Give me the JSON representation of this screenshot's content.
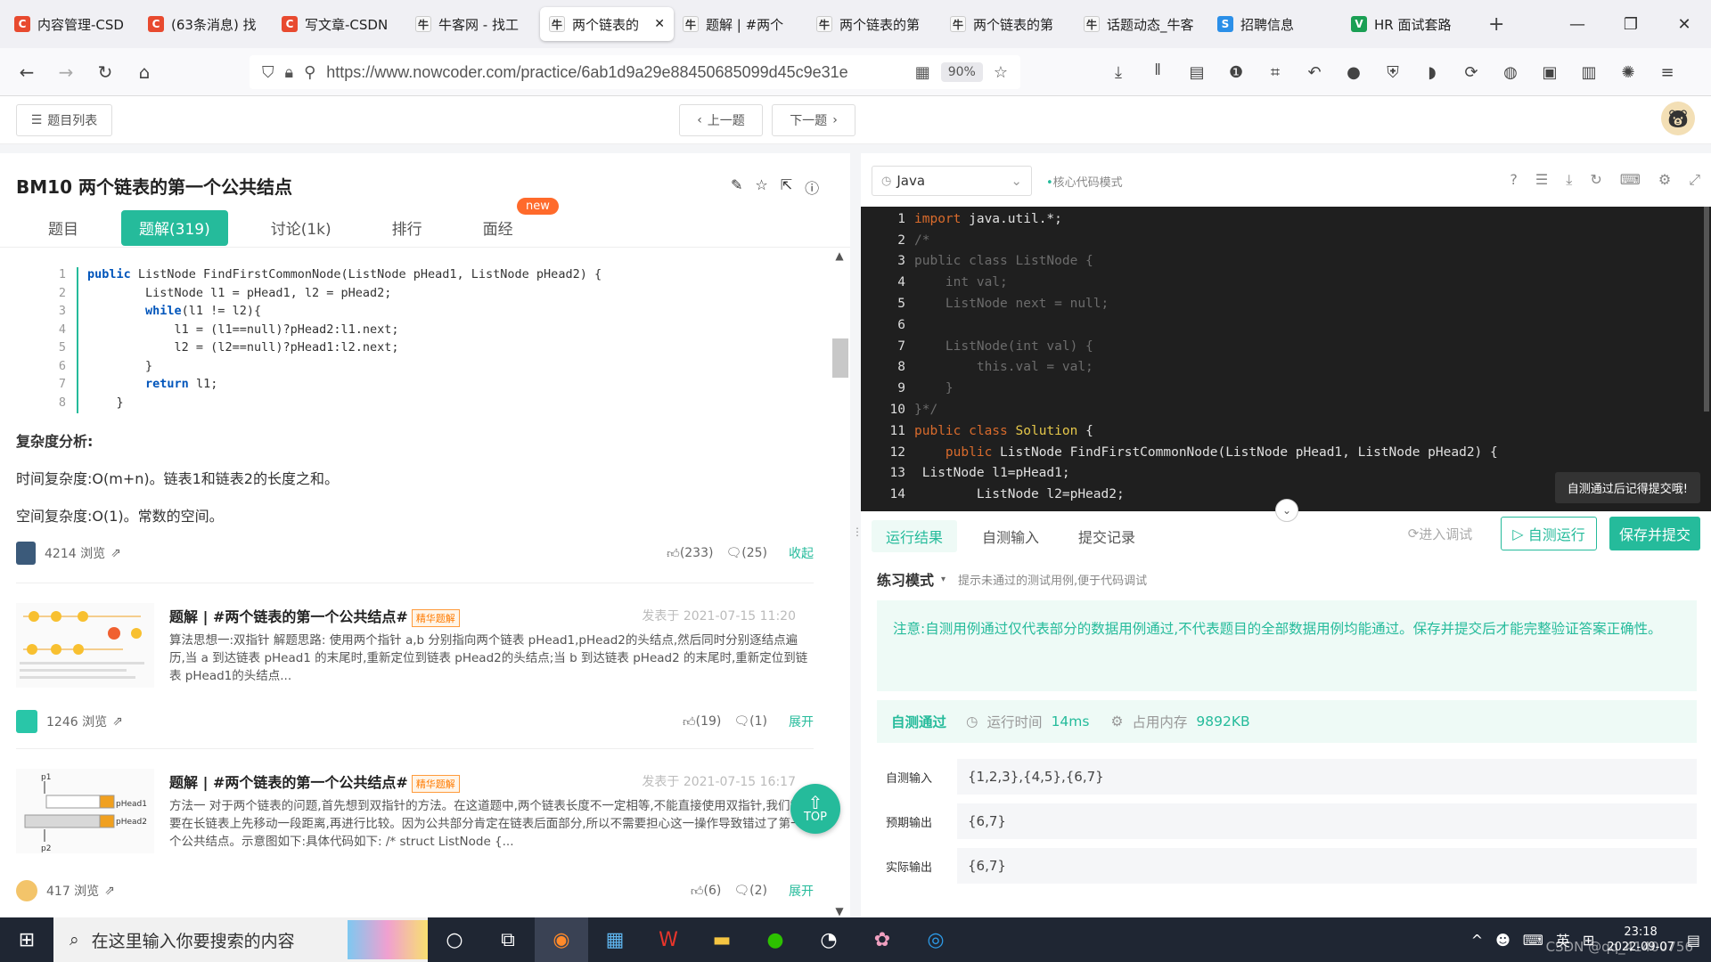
{
  "browser": {
    "tabs": [
      {
        "icon": "C",
        "color": "#e84a2f",
        "label": "内容管理-CSD"
      },
      {
        "icon": "C",
        "color": "#e84a2f",
        "label": "(63条消息) 找"
      },
      {
        "icon": "C",
        "color": "#e84a2f",
        "label": "写文章-CSDN"
      },
      {
        "icon": "牛",
        "color": "#f8f8f8",
        "label": "牛客网 - 找工"
      },
      {
        "icon": "牛",
        "color": "#f8f8f8",
        "label": "两个链表的",
        "active": true
      },
      {
        "icon": "牛",
        "color": "#f8f8f8",
        "label": "题解 | #两个"
      },
      {
        "icon": "牛",
        "color": "#f8f8f8",
        "label": "两个链表的第"
      },
      {
        "icon": "牛",
        "color": "#f8f8f8",
        "label": "两个链表的第"
      },
      {
        "icon": "牛",
        "color": "#f8f8f8",
        "label": "话题动态_牛客"
      },
      {
        "icon": "S",
        "color": "#2b8fe8",
        "label": "招聘信息"
      },
      {
        "icon": "V",
        "color": "#1a9f54",
        "label": "HR 面试套路"
      }
    ],
    "url": "https://www.nowcoder.com/practice/6ab1d9a29e88450685099d45c9e31e",
    "zoom": "90%"
  },
  "subheader": {
    "list_label": "题目列表",
    "prev_label": "上一题",
    "next_label": "下一题"
  },
  "problem": {
    "title": "BM10  两个链表的第一个公共结点",
    "tabs": [
      "题目",
      "题解(319)",
      "讨论(1k)",
      "排行",
      "面经"
    ],
    "new_badge": "new"
  },
  "solution_code": [
    {
      "n": "1",
      "pre": "",
      "kw": "public",
      "rest": " ListNode FindFirstCommonNode(ListNode pHead1, ListNode pHead2) {"
    },
    {
      "n": "2",
      "pre": "        ",
      "kw": "",
      "rest": "ListNode l1 = pHead1, l2 = pHead2;"
    },
    {
      "n": "3",
      "pre": "        ",
      "kw": "while",
      "rest": "(l1 != l2){"
    },
    {
      "n": "4",
      "pre": "            ",
      "kw": "",
      "rest": "l1 = (l1==null)?pHead2:l1.next;"
    },
    {
      "n": "5",
      "pre": "            ",
      "kw": "",
      "rest": "l2 = (l2==null)?pHead1:l2.next;"
    },
    {
      "n": "6",
      "pre": "        ",
      "kw": "",
      "rest": "}"
    },
    {
      "n": "7",
      "pre": "        ",
      "kw": "return",
      "rest": " l1;"
    },
    {
      "n": "8",
      "pre": "    ",
      "kw": "",
      "rest": "}"
    }
  ],
  "complexity": {
    "heading": "复杂度分析:",
    "time": "时间复杂度:O(m+n)。链表1和链表2的长度之和。",
    "space": "空间复杂度:O(1)。常数的空间。"
  },
  "first_post": {
    "views": "4214 浏览",
    "likes": "(233)",
    "comments": "(25)",
    "toggle": "收起"
  },
  "cards": [
    {
      "title": "题解 | #两个链表的第一个公共结点#",
      "badge": "精华题解",
      "date": "发表于 2021-07-15 11:20",
      "body": "算法思想一:双指针 解题思路: 使用两个指针 a,b 分别指向两个链表 pHead1,pHead2的头结点,然后同时分别逐结点遍历,当 a 到达链表 pHead1 的末尾时,重新定位到链表 pHead2的头结点;当 b 到达链表 pHead2 的末尾时,重新定位到链表 pHead1的头结点...",
      "views": "1246 浏览",
      "likes": "(19)",
      "comments": "(1)",
      "toggle": "展开"
    },
    {
      "title": "题解 | #两个链表的第一个公共结点#",
      "badge": "精华题解",
      "date": "发表于 2021-07-15 16:17",
      "body": "方法一 对于两个链表的问题,首先想到双指针的方法。在这道题中,两个链表长度不一定相等,不能直接使用双指针,我们需要在长链表上先移动一段距离,再进行比较。因为公共部分肯定在链表后面部分,所以不需要担心这一操作导致错过了第一个公共结点。示意图如下:具体代码如下: /* struct ListNode {...",
      "views": "417 浏览",
      "likes": "(6)",
      "comments": "(2)",
      "toggle": "展开",
      "thumb_labels": [
        "p1",
        "pHead1",
        "pHead2",
        "p2"
      ]
    }
  ],
  "top_button": "TOP",
  "editor": {
    "language": "Java",
    "mode": "核心代码模式",
    "lines": [
      {
        "n": "1",
        "segs": [
          [
            "k",
            "import"
          ],
          [
            "t",
            " java.util.*;"
          ]
        ]
      },
      {
        "n": "2",
        "segs": [
          [
            "c",
            "/*"
          ]
        ]
      },
      {
        "n": "3",
        "segs": [
          [
            "c",
            "public class ListNode {"
          ]
        ]
      },
      {
        "n": "4",
        "segs": [
          [
            "c",
            "    int val;"
          ]
        ]
      },
      {
        "n": "5",
        "segs": [
          [
            "c",
            "    ListNode next = null;"
          ]
        ]
      },
      {
        "n": "6",
        "segs": []
      },
      {
        "n": "7",
        "segs": [
          [
            "c",
            "    ListNode(int val) {"
          ]
        ]
      },
      {
        "n": "8",
        "segs": [
          [
            "c",
            "        this.val = val;"
          ]
        ]
      },
      {
        "n": "9",
        "segs": [
          [
            "c",
            "    }"
          ]
        ]
      },
      {
        "n": "10",
        "segs": [
          [
            "c",
            "}*/"
          ]
        ]
      },
      {
        "n": "11",
        "segs": [
          [
            "k",
            "public class"
          ],
          [
            "t",
            " "
          ],
          [
            "y",
            "Solution"
          ],
          [
            "t",
            " {"
          ]
        ]
      },
      {
        "n": "12",
        "segs": [
          [
            "t",
            "    "
          ],
          [
            "k",
            "public"
          ],
          [
            "t",
            " ListNode FindFirstCommonNode(ListNode pHead1, ListNode pHead2) {"
          ]
        ]
      },
      {
        "n": "13",
        "segs": [
          [
            "t",
            " ListNode l1=pHead1;"
          ]
        ]
      },
      {
        "n": "14",
        "segs": [
          [
            "t",
            "        ListNode l2=pHead2;"
          ]
        ]
      }
    ],
    "tooltip": "自测通过后记得提交哦!"
  },
  "results": {
    "tabs": [
      "运行结果",
      "自测输入",
      "提交记录"
    ],
    "debug_label": "进入调试",
    "run_label": "自测运行",
    "submit_label": "保存并提交",
    "practice_mode": "练习模式",
    "practice_hint": "提示未通过的测试用例,便于代码调试",
    "note": "注意:自测用例通过仅代表部分的数据用例通过,不代表题目的全部数据用例均能通过。保存并提交后才能完整验证答案正确性。",
    "status": "自测通过",
    "runtime_label": "运行时间",
    "runtime": "14ms",
    "memory_label": "占用内存",
    "memory": "9892KB",
    "rows": [
      {
        "label": "自测输入",
        "value": "{1,2,3},{4,5},{6,7}"
      },
      {
        "label": "预期输出",
        "value": "{6,7}"
      },
      {
        "label": "实际输出",
        "value": "{6,7}"
      }
    ]
  },
  "taskbar": {
    "search_placeholder": "在这里输入你要搜索的内容",
    "ime": "英",
    "time": "23:18",
    "date": "2022-09-07",
    "watermark": "CSDN @qq_41400756"
  },
  "colors": {
    "accent": "#25bb9b",
    "orange": "#ff6a2b"
  }
}
